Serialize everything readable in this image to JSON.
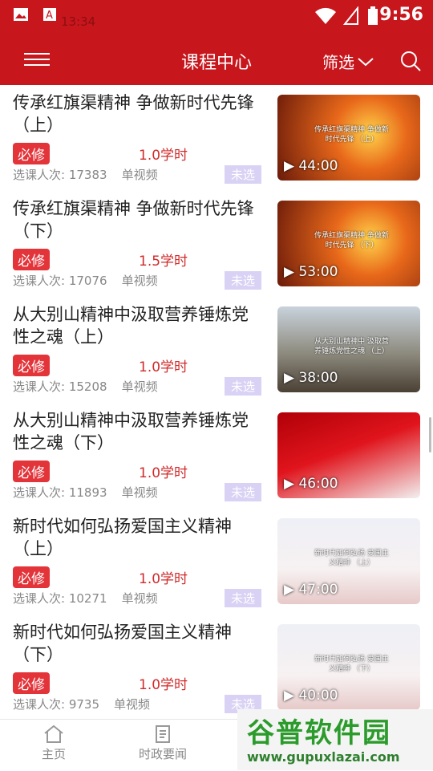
{
  "status": {
    "left_time": "13:34",
    "time": "9:56"
  },
  "header": {
    "title": "课程中心",
    "filter_label": "筛选"
  },
  "courses": [
    {
      "title": "传承红旗渠精神 争做新时代先锋（上）",
      "badge": "必修",
      "credit": "1.0学时",
      "count_label": "选课人次:",
      "count": "17383",
      "mode": "单视频",
      "status": "未选",
      "duration": "44:00",
      "thumb_caption": "传承红旗渠精神 争做新时代先锋 （上）"
    },
    {
      "title": "传承红旗渠精神 争做新时代先锋（下）",
      "badge": "必修",
      "credit": "1.5学时",
      "count_label": "选课人次:",
      "count": "17076",
      "mode": "单视频",
      "status": "未选",
      "duration": "53:00",
      "thumb_caption": "传承红旗渠精神 争做新时代先锋 （下）"
    },
    {
      "title": "从大别山精神中汲取营养锤炼党性之魂（上）",
      "badge": "必修",
      "credit": "1.0学时",
      "count_label": "选课人次:",
      "count": "15208",
      "mode": "单视频",
      "status": "未选",
      "duration": "38:00",
      "thumb_caption": "从大别山精神中 汲取营养锤炼党性之魂 （上）"
    },
    {
      "title": "从大别山精神中汲取营养锤炼党性之魂（下）",
      "badge": "必修",
      "credit": "1.0学时",
      "count_label": "选课人次:",
      "count": "11893",
      "mode": "单视频",
      "status": "未选",
      "duration": "46:00",
      "thumb_caption": ""
    },
    {
      "title": "新时代如何弘扬爱国主义精神（上）",
      "badge": "必修",
      "credit": "1.0学时",
      "count_label": "选课人次:",
      "count": "10271",
      "mode": "单视频",
      "status": "未选",
      "duration": "47:00",
      "thumb_caption": "新时代如何弘扬 爱国主义精神 （上）"
    },
    {
      "title": "新时代如何弘扬爱国主义精神（下）",
      "badge": "必修",
      "credit": "1.0学时",
      "count_label": "选课人次:",
      "count": "9735",
      "mode": "单视频",
      "status": "未选",
      "duration": "40:00",
      "thumb_caption": "新时代如何弘扬 爱国主义精神 （下）"
    }
  ],
  "tabs": [
    {
      "label": "主页"
    },
    {
      "label": "时政要闻"
    }
  ],
  "watermark": {
    "title": "谷普软件园",
    "url": "www.gupuxlazai.com"
  }
}
